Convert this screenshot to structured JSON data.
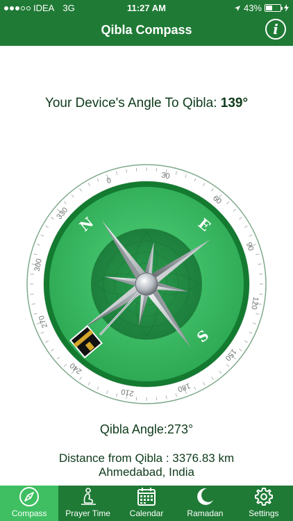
{
  "status_bar": {
    "carrier": "IDEA",
    "network": "3G",
    "time": "11:27 AM",
    "battery": "43%",
    "battery_level": 0.43
  },
  "header": {
    "title": "Qibla Compass"
  },
  "info": {
    "angle_prefix": "Your Device's Angle To Qibla:",
    "angle_value": "139°",
    "qibla_angle_label": "Qibla Angle:",
    "qibla_angle_value": "273°",
    "distance_text": "Distance from Qibla : 3376.83 km",
    "location": "Ahmedabad, India"
  },
  "compass": {
    "scale_labels": [
      "0",
      "30",
      "60",
      "90",
      "120",
      "150",
      "180",
      "210",
      "240",
      "270",
      "300",
      "330"
    ],
    "cardinals": [
      "N",
      "E",
      "S"
    ],
    "colors": {
      "ring_green": "#1a8a3a",
      "inner_green": "#3fbf62",
      "center_green": "#23924a"
    }
  },
  "tabs": [
    {
      "label": "Compass",
      "icon": "compass-icon",
      "active": true
    },
    {
      "label": "Prayer Time",
      "icon": "prayer-icon",
      "active": false
    },
    {
      "label": "Calendar",
      "icon": "calendar-icon",
      "active": false
    },
    {
      "label": "Ramadan",
      "icon": "crescent-moon-icon",
      "active": false
    },
    {
      "label": "Settings",
      "icon": "gear-icon",
      "active": false
    }
  ]
}
